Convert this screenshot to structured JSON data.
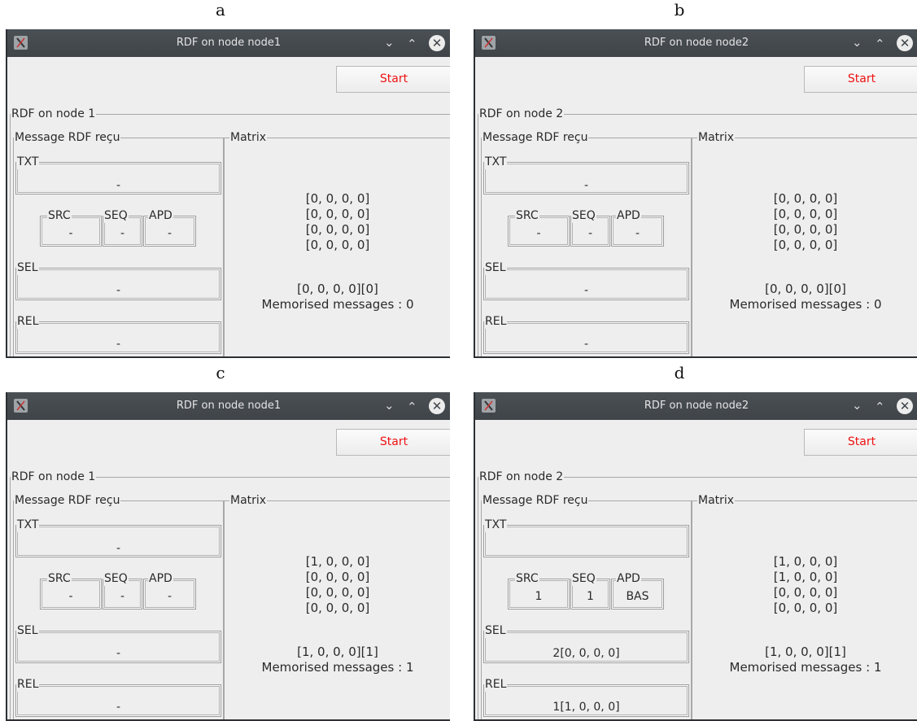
{
  "panels": [
    {
      "caption": "a",
      "window_title": "RDF on node node1",
      "start_label": "Start",
      "outer_legend": "RDF on node 1",
      "message_legend": "Message RDF reçu",
      "matrix_legend": "Matrix",
      "txt": {
        "label": "TXT",
        "value": "-"
      },
      "src": {
        "label": "SRC",
        "value": "-"
      },
      "seq": {
        "label": "SEQ",
        "value": "-"
      },
      "apd": {
        "label": "APD",
        "value": "-"
      },
      "sel": {
        "label": "SEL",
        "value": "-"
      },
      "rel": {
        "label": "REL",
        "value": "-"
      },
      "matrix_rows": [
        "[0, 0, 0, 0]",
        "[0, 0, 0, 0]",
        "[0, 0, 0, 0]",
        "[0, 0, 0, 0]"
      ],
      "vector": "[0, 0, 0, 0][0]",
      "memorised": "Memorised messages : 0"
    },
    {
      "caption": "b",
      "window_title": "RDF on node node2",
      "start_label": "Start",
      "outer_legend": "RDF on node 2",
      "message_legend": "Message RDF reçu",
      "matrix_legend": "Matrix",
      "txt": {
        "label": "TXT",
        "value": "-"
      },
      "src": {
        "label": "SRC",
        "value": "-"
      },
      "seq": {
        "label": "SEQ",
        "value": "-"
      },
      "apd": {
        "label": "APD",
        "value": "-"
      },
      "sel": {
        "label": "SEL",
        "value": "-"
      },
      "rel": {
        "label": "REL",
        "value": "-"
      },
      "matrix_rows": [
        "[0, 0, 0, 0]",
        "[0, 0, 0, 0]",
        "[0, 0, 0, 0]",
        "[0, 0, 0, 0]"
      ],
      "vector": "[0, 0, 0, 0][0]",
      "memorised": "Memorised messages : 0"
    },
    {
      "caption": "c",
      "window_title": "RDF on node node1",
      "start_label": "Start",
      "outer_legend": "RDF on node 1",
      "message_legend": "Message RDF reçu",
      "matrix_legend": "Matrix",
      "txt": {
        "label": "TXT",
        "value": "-"
      },
      "src": {
        "label": "SRC",
        "value": "-"
      },
      "seq": {
        "label": "SEQ",
        "value": "-"
      },
      "apd": {
        "label": "APD",
        "value": "-"
      },
      "sel": {
        "label": "SEL",
        "value": "-"
      },
      "rel": {
        "label": "REL",
        "value": "-"
      },
      "matrix_rows": [
        "[1, 0, 0, 0]",
        "[0, 0, 0, 0]",
        "[0, 0, 0, 0]",
        "[0, 0, 0, 0]"
      ],
      "vector": "[1, 0, 0, 0][1]",
      "memorised": "Memorised messages : 1"
    },
    {
      "caption": "d",
      "window_title": "RDF on node node2",
      "start_label": "Start",
      "outer_legend": "RDF on node 2",
      "message_legend": "Message RDF reçu",
      "matrix_legend": "Matrix",
      "txt": {
        "label": "TXT",
        "value": ""
      },
      "src": {
        "label": "SRC",
        "value": "1"
      },
      "seq": {
        "label": "SEQ",
        "value": "1"
      },
      "apd": {
        "label": "APD",
        "value": "BAS"
      },
      "sel": {
        "label": "SEL",
        "value": "2[0, 0, 0, 0]"
      },
      "rel": {
        "label": "REL",
        "value": "1[1, 0, 0, 0]"
      },
      "matrix_rows": [
        "[1, 0, 0, 0]",
        "[1, 0, 0, 0]",
        "[0, 0, 0, 0]",
        "[0, 0, 0, 0]"
      ],
      "vector": "[1, 0, 0, 0][1]",
      "memorised": "Memorised messages : 1"
    }
  ],
  "icons": {
    "app": "x-window-app-icon",
    "minimize": "chevron-down-icon",
    "maximize": "chevron-up-icon",
    "close": "close-circle-icon"
  },
  "colors": {
    "titlebar": "#43484d",
    "window_bg": "#eeeeee",
    "start_text": "#ee1111"
  }
}
